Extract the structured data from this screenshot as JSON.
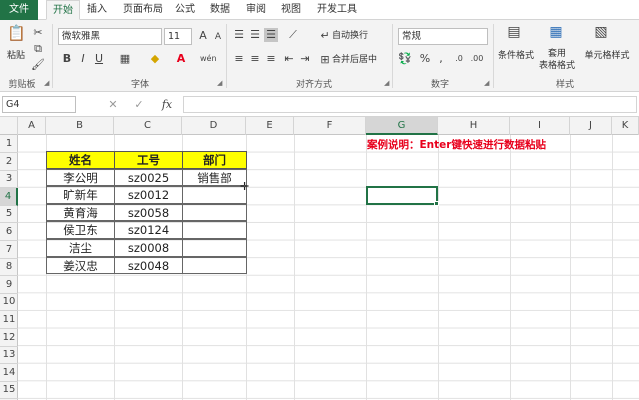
{
  "tabs": [
    "文件",
    "开始",
    "插入",
    "页面布局",
    "公式",
    "数据",
    "审阅",
    "视图",
    "开发工具"
  ],
  "ribbon": {
    "clipboard": {
      "paste": "粘贴",
      "label": "剪贴板"
    },
    "font": {
      "name": "微软雅黑",
      "size": "11",
      "grow": "A",
      "shrink": "A",
      "bold": "B",
      "italic": "I",
      "underline": "U",
      "wen": "wén",
      "label": "字体"
    },
    "alignment": {
      "wrap": "自动换行",
      "merge": "合并后居中",
      "label": "对齐方式"
    },
    "number": {
      "format": "常规",
      "label": "数字"
    },
    "styles": {
      "conditional": "条件格式",
      "table_format": "套用\n表格格式",
      "cell_style": "单元格样式",
      "label": "样式"
    }
  },
  "formula_bar": {
    "name_box": "G4",
    "formula": "",
    "fx": "fx",
    "cancel": "✕",
    "enter": "✓"
  },
  "columns": [
    "A",
    "B",
    "C",
    "D",
    "E",
    "F",
    "G",
    "H",
    "I",
    "J",
    "K"
  ],
  "rows": [
    "1",
    "2",
    "3",
    "4",
    "5",
    "6",
    "7",
    "8",
    "9",
    "10",
    "11",
    "12",
    "13",
    "14",
    "15"
  ],
  "selected": {
    "column": "G",
    "row": "4"
  },
  "table": {
    "headers": [
      "姓名",
      "工号",
      "部门"
    ],
    "rows": [
      [
        "李公明",
        "sz0025",
        "销售部"
      ],
      [
        "旷新年",
        "sz0012",
        ""
      ],
      [
        "黄育海",
        "sz0058",
        ""
      ],
      [
        "侯卫东",
        "sz0124",
        ""
      ],
      [
        "洁尘",
        "sz0008",
        ""
      ],
      [
        "姜汉忠",
        "sz0048",
        ""
      ]
    ]
  },
  "note": "案例说明：Enter键快速进行数据粘贴",
  "colors": {
    "accent": "#217346",
    "header_fill": "#ffff00",
    "note": "#e8001c"
  }
}
